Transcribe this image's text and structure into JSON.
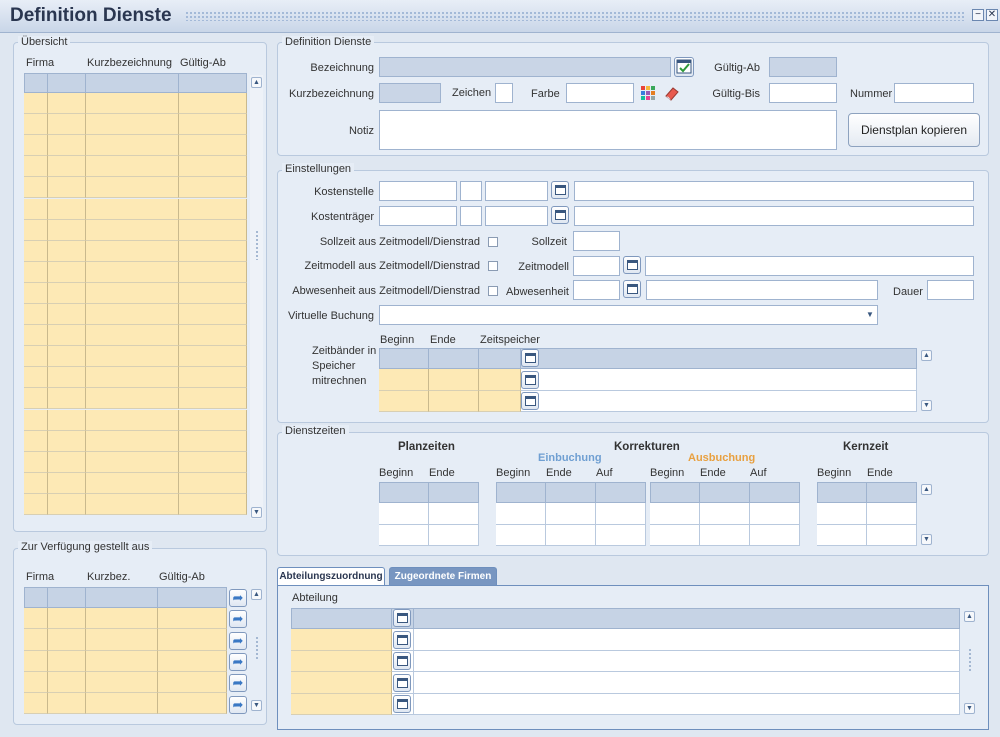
{
  "window": {
    "title": "Definition Dienste",
    "minimize": "−",
    "close": "✕"
  },
  "uebersicht": {
    "legend": "Übersicht",
    "columns": [
      "Firma",
      "",
      "Kurzbezeichnung",
      "Gültig-Ab"
    ],
    "row_count": 20
  },
  "verfuegung": {
    "legend": "Zur Verfügung gestellt aus",
    "columns": [
      "Firma",
      "",
      "Kurzbez.",
      "Gültig-Ab"
    ],
    "row_count": 5
  },
  "definition": {
    "legend": "Definition Dienste",
    "bezeichnung_label": "Bezeichnung",
    "kurzbezeichnung_label": "Kurzbezeichnung",
    "zeichen_label": "Zeichen",
    "farbe_label": "Farbe",
    "notiz_label": "Notiz",
    "gueltig_ab_label": "Gültig-Ab",
    "gueltig_bis_label": "Gültig-Bis",
    "nummer_label": "Nummer",
    "kopieren_button": "Dienstplan kopieren"
  },
  "einstellungen": {
    "legend": "Einstellungen",
    "kostenstelle_label": "Kostenstelle",
    "kostentraeger_label": "Kostenträger",
    "sollzeit_check_label": "Sollzeit aus Zeitmodell/Dienstrad",
    "sollzeit_label": "Sollzeit",
    "zeitmodell_check_label": "Zeitmodell aus Zeitmodell/Dienstrad",
    "zeitmodell_label": "Zeitmodell",
    "abwesenheit_check_label": "Abwesenheit aus Zeitmodell/Dienstrad",
    "abwesenheit_label": "Abwesenheit",
    "dauer_label": "Dauer",
    "virtuelle_label": "Virtuelle Buchung",
    "zeitbaender_label_1": "Zeitbänder in",
    "zeitbaender_label_2": "Speicher",
    "zeitbaender_label_3": "mitrechnen",
    "zb_columns": [
      "Beginn",
      "Ende",
      "Zeitspeicher"
    ]
  },
  "dienstzeiten": {
    "legend": "Dienstzeiten",
    "planzeiten": "Planzeiten",
    "korrekturen": "Korrekturen",
    "einbuchung": "Einbuchung",
    "ausbuchung": "Ausbuchung",
    "kernzeit": "Kernzeit",
    "plan_cols": [
      "Beginn",
      "Ende"
    ],
    "ein_cols": [
      "Beginn",
      "Ende",
      "Auf"
    ],
    "aus_cols": [
      "Beginn",
      "Ende",
      "Auf"
    ],
    "kern_cols": [
      "Beginn",
      "Ende"
    ],
    "colors": {
      "einbuchung": "#6f9fd2",
      "ausbuchung": "#e8a040"
    }
  },
  "tabs": {
    "abteilung_tab": "Abteilungszuordnung",
    "firmen_tab": "Zugeordnete Firmen",
    "abteilung_header": "Abteilung"
  },
  "colors": {
    "row_yellow": "#fde9b5",
    "header_blue": "#c6d3e5",
    "tab_active": "#ffffff",
    "tab_inactive": "#7896c1"
  }
}
